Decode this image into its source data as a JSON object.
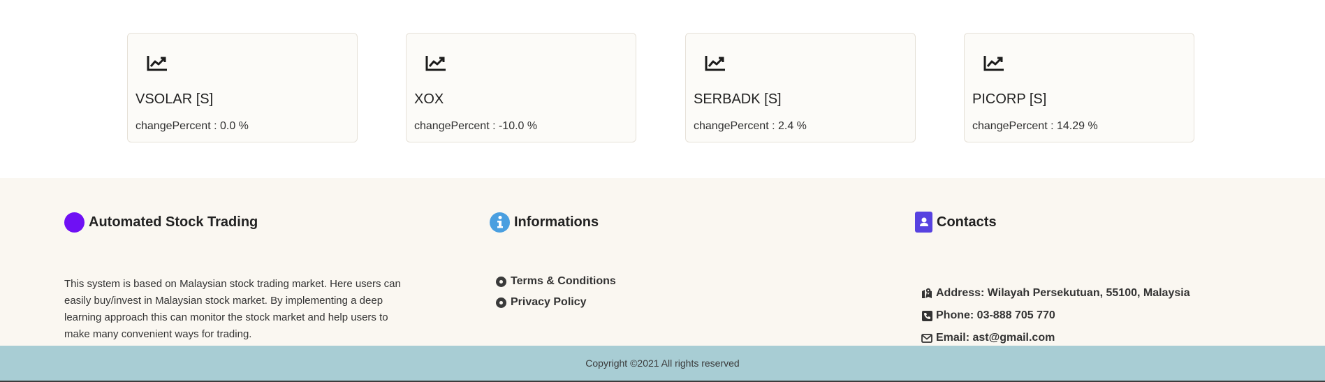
{
  "stocks": [
    {
      "name": "VSOLAR [S]",
      "change_label": "changePercent : ",
      "change_value": "0.0",
      "change_unit": " %"
    },
    {
      "name": "XOX",
      "change_label": "changePercent : ",
      "change_value": "-10.0",
      "change_unit": " %"
    },
    {
      "name": "SERBADK [S]",
      "change_label": "changePercent : ",
      "change_value": "2.4",
      "change_unit": " %"
    },
    {
      "name": "PICORP [S]",
      "change_label": "changePercent : ",
      "change_value": "14.29",
      "change_unit": " %"
    }
  ],
  "icons": {
    "stock_card": "chart-line-icon",
    "brand": "brand-dot-icon",
    "informations": "info-circle-icon",
    "contacts": "address-book-icon",
    "address": "map-location-icon",
    "phone": "phone-square-icon",
    "email": "envelope-icon",
    "link_bullet": "dot-circle-icon"
  },
  "footer": {
    "brand": {
      "title": "Automated Stock Trading",
      "description": "This system is based on Malaysian stock trading market. Here users can easily buy/invest in Malaysian stock market. By implementing a deep learning approach this can monitor the stock market and help users to make many convenient ways for trading."
    },
    "informations": {
      "title": "Informations",
      "links": [
        "Terms & Conditions",
        "Privacy Policy"
      ]
    },
    "contacts": {
      "title": "Contacts",
      "address": "Address: Wilayah Persekutuan, 55100, Malaysia",
      "phone": "Phone: 03-888 705 770",
      "email": "Email: ast@gmail.com"
    }
  },
  "copyright": "Copyright ©2021 All rights reserved",
  "colors": {
    "brand_dot": "#6f10f4",
    "info_badge": "#4a9fe0",
    "contact_badge": "#5742e0",
    "footer_bg": "#faf7f1",
    "copyright_bg": "#a8cdd4",
    "card_bg": "#fcfbf8"
  }
}
